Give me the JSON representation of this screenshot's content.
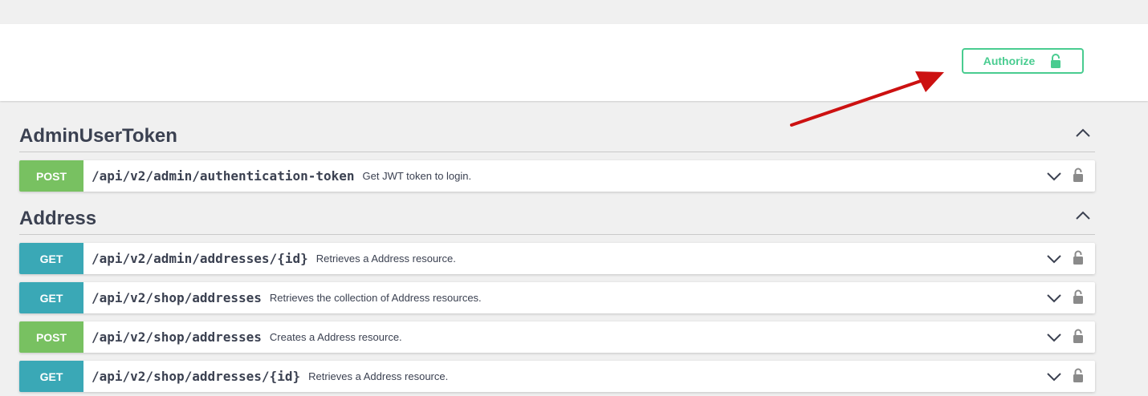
{
  "colors": {
    "post": "#78c161",
    "get": "#3aa8b6",
    "authorize": "#49cc90",
    "arrow": "#cc1111",
    "text": "#3b4151"
  },
  "auth": {
    "label": "Authorize",
    "icon": "unlocked-lock-icon"
  },
  "sections": [
    {
      "title": "AdminUserToken",
      "operations": [
        {
          "method": "POST",
          "path": "/api/v2/admin/authentication-token",
          "description": "Get JWT token to login."
        }
      ]
    },
    {
      "title": "Address",
      "operations": [
        {
          "method": "GET",
          "path": "/api/v2/admin/addresses/{id}",
          "description": "Retrieves a Address resource."
        },
        {
          "method": "GET",
          "path": "/api/v2/shop/addresses",
          "description": "Retrieves the collection of Address resources."
        },
        {
          "method": "POST",
          "path": "/api/v2/shop/addresses",
          "description": "Creates a Address resource."
        },
        {
          "method": "GET",
          "path": "/api/v2/shop/addresses/{id}",
          "description": "Retrieves a Address resource."
        }
      ]
    }
  ]
}
